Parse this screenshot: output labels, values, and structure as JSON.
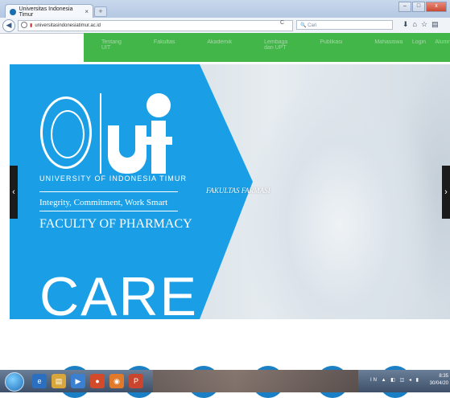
{
  "browser": {
    "tab_title": "Universitas Indonesia Timur",
    "tab_close": "×",
    "new_tab": "+",
    "url": "universitasindonesiatimur.ac.id",
    "search_placeholder": "Cari",
    "window_buttons": [
      "–",
      "□",
      "x"
    ]
  },
  "site_menu": {
    "items": [
      "Tentang UIT",
      "Fakultas",
      "Akademik",
      "Lembaga dan UPT",
      "Publikasi",
      "Mahasiswa",
      "Alumni"
    ],
    "login": "Login"
  },
  "hero": {
    "university": "UNIVERSITY OF INDONESIA TIMUR",
    "tagline": "Integrity, Commitment, Work Smart",
    "faculty": "FACULTY OF PHARMACY",
    "big_word": "CARE",
    "caption": "FAKULTAS FARMASI",
    "prev_arrow": "‹",
    "next_arrow": "›",
    "brand_color": "#1a9fe6",
    "menu_color": "#43b64a"
  },
  "taskbar": {
    "tray": "IN ▲ ◧ ◫ ◂ ▮",
    "time": "8:35",
    "date": "30/04/20"
  }
}
